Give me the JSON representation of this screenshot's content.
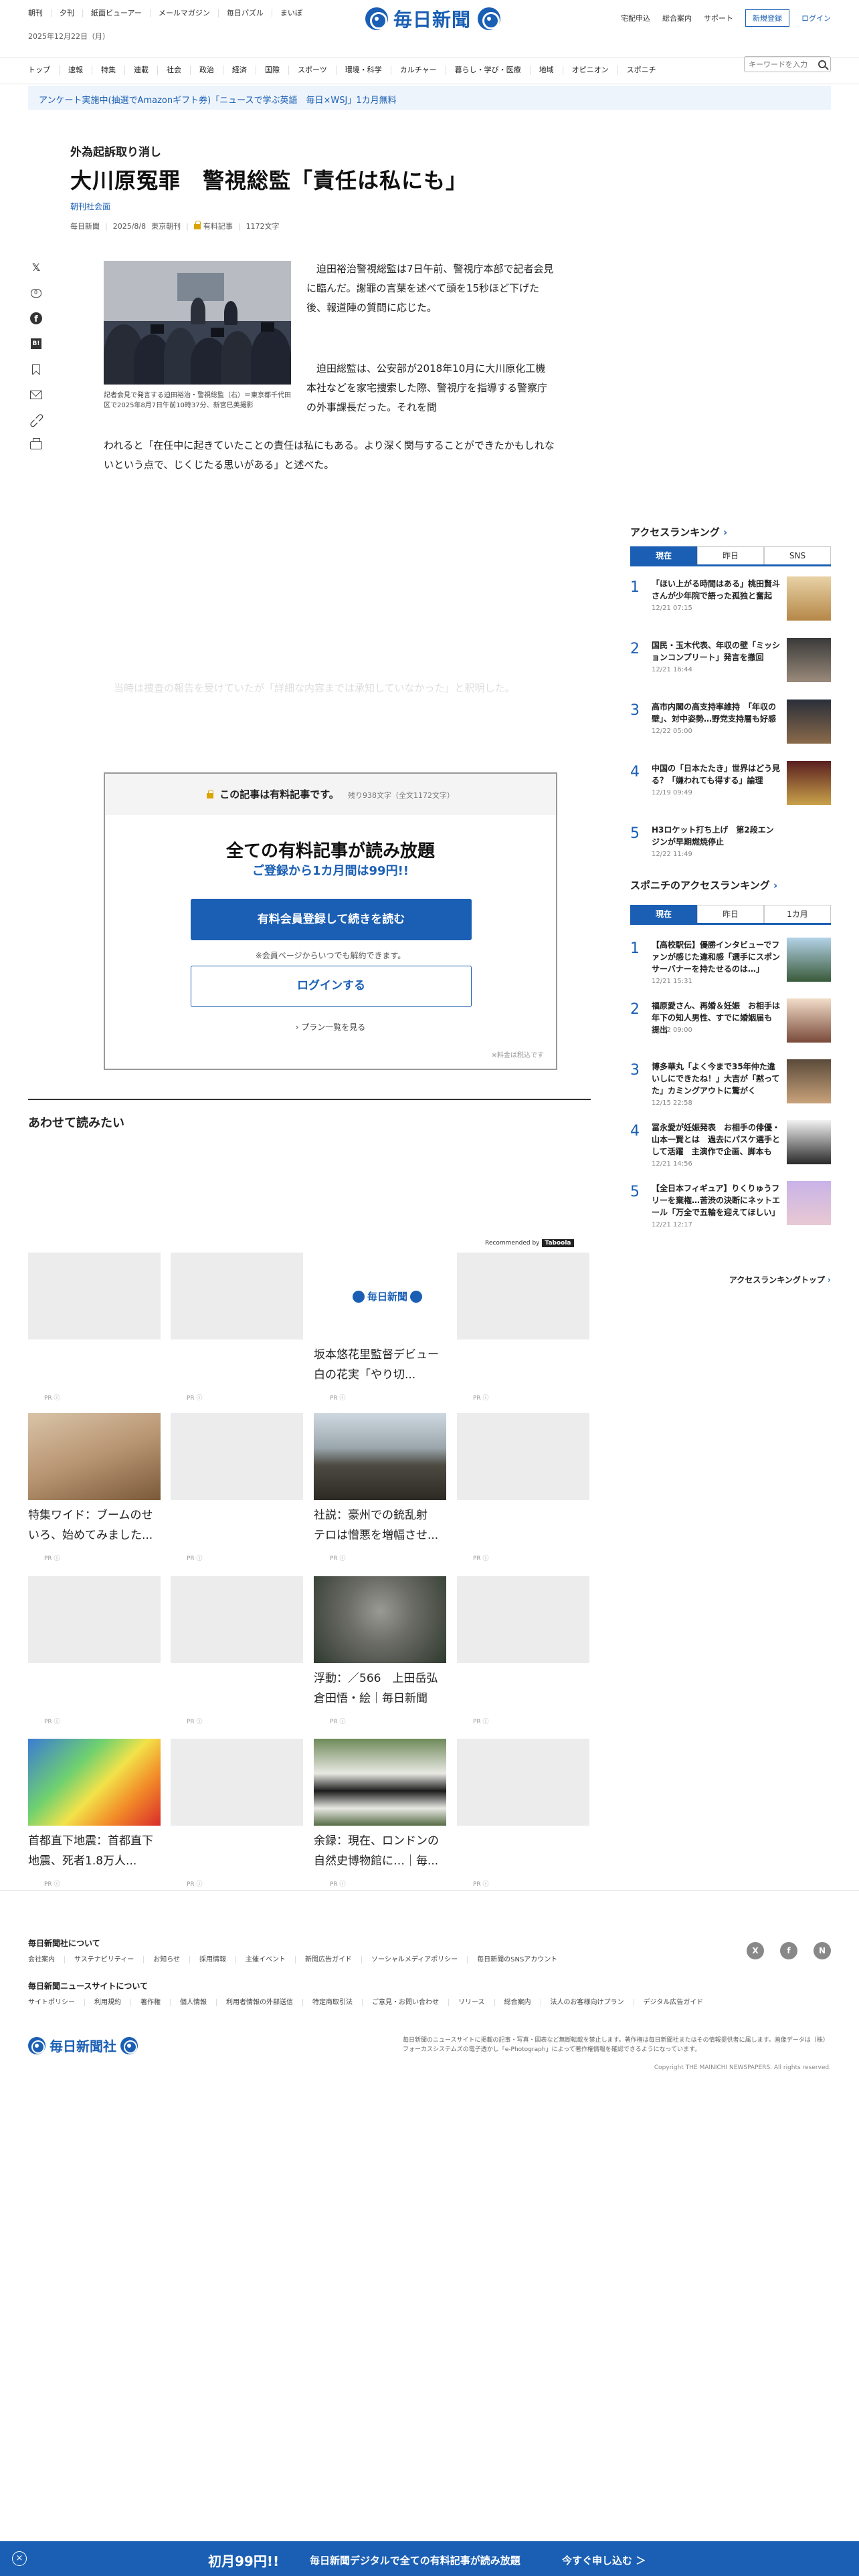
{
  "header": {
    "left_links": [
      "朝刊",
      "夕刊",
      "紙面ビューアー",
      "メールマガジン",
      "毎日パズル",
      "まいぽ"
    ],
    "date": "2025年12月22日（月）",
    "logo_text": "毎日新聞",
    "right_links": [
      "宅配申込",
      "総合案内",
      "サポート"
    ],
    "register_label": "新規登録",
    "login_label": "ログイン"
  },
  "nav": {
    "items": [
      "トップ",
      "速報",
      "特集",
      "連載",
      "社会",
      "政治",
      "経済",
      "国際",
      "スポーツ",
      "環境・科学",
      "カルチャー",
      "暮らし・学び・医療",
      "地域",
      "オピニオン",
      "スポニチ"
    ],
    "search_placeholder": "キーワードを入力"
  },
  "banner": {
    "text": "アンケート実施中(抽選でAmazonギフト券)「ニュースで学ぶ英語　毎日×WSJ」1カ月無料"
  },
  "article": {
    "kicker": "外為起訴取り消し",
    "headline": "大川原冤罪　警視総監「責任は私にも」",
    "section": "朝刊社会面",
    "source": "毎日新聞",
    "date": "2025/8/8",
    "edition": "東京朝刊",
    "paid_label": "有料記事",
    "char_count": "1172文字",
    "caption": "記者会見で発言する迫田裕治・警視総監（右）＝東京都千代田区で2025年8月7日午前10時37分、新宮巳美撮影",
    "para1": "迫田裕治警視総監は7日午前、警視庁本部で記者会見に臨んだ。謝罪の言葉を述べて頭を15秒ほど下げた後、報道陣の質問に応じた。",
    "para2_a": "迫田総監は、公安部が2018年10月に大川原化工機本社などを家宅捜索した際、警視庁を指導する警察庁の外事課長だった。それを問われると「在任中に起きていたことの責任は私にもある。より深く関与することができたかもしれないという点で、じくじたる思いがある」と述べた。",
    "faded": "当時は捜査の報告を受けていたが「詳細な内容までは承知していなかった」と釈明した。"
  },
  "paywall": {
    "head": "この記事は有料記事です。",
    "remaining": "残り938文字（全文1172文字）",
    "title": "全ての有料記事が読み放題",
    "subtitle": "ご登録から1カ月間は99円!!",
    "primary_button": "有料会員登録して続きを読む",
    "note": "※会員ページからいつでも解約できます。",
    "login_button": "ログインする",
    "plans_link": "プラン一覧を見る",
    "tax": "※料金は税込です"
  },
  "related": {
    "heading": "あわせて読みたい",
    "recommended_by": "Recommended by",
    "taboola": "Taboola",
    "pr": "PR",
    "cards": [
      {
        "title": ""
      },
      {
        "title": ""
      },
      {
        "title": "坂本悠花里監督デビュー　白の花実「やり切..."
      },
      {
        "title": ""
      },
      {
        "title": "特集ワイド：ブームのせいろ、始めてみました..."
      },
      {
        "title": ""
      },
      {
        "title": "社説：豪州での銃乱射　テロは憎悪を増幅させ..."
      },
      {
        "title": ""
      },
      {
        "title": ""
      },
      {
        "title": ""
      },
      {
        "title": "浮動：／566　上田岳弘　倉田悟・絵｜毎日新聞"
      },
      {
        "title": ""
      },
      {
        "title": "首都直下地震：首都直下地震、死者1.8万人..."
      },
      {
        "title": ""
      },
      {
        "title": "余録：現在、ロンドンの自然史博物館に…｜毎..."
      },
      {
        "title": ""
      }
    ]
  },
  "sidebar": {
    "ranking_title": "アクセスランキング",
    "ranking_tabs": [
      "現在",
      "昨日",
      "SNS"
    ],
    "ranking": [
      {
        "num": "1",
        "text": "「ほい上がる時間はある」桃田賢斗さんが少年院で語った孤独と奮起",
        "time": "12/21 07:15"
      },
      {
        "num": "2",
        "text": "国民・玉木代表、年収の壁「ミッションコンプリート」発言を撤回",
        "time": "12/21 16:44"
      },
      {
        "num": "3",
        "text": "高市内閣の高支持率維持　「年収の壁」、対中姿勢…野党支持層も好感",
        "time": "12/22 05:00"
      },
      {
        "num": "4",
        "text": "中国の「日本たたき」世界はどう見る？「嫌われても得する」論理",
        "time": "12/19 09:49"
      },
      {
        "num": "5",
        "text": "H3ロケット打ち上げ　第2段エンジンが早期燃焼停止",
        "time": "12/22 11:49"
      }
    ],
    "sponichi_title": "スポニチのアクセスランキング",
    "sponichi_tabs": [
      "現在",
      "昨日",
      "1カ月"
    ],
    "sponichi": [
      {
        "num": "1",
        "text": "【高校駅伝】優勝インタビューでファンが感じた違和感「選手にスポンサーバナーを持たせるのは…」",
        "time": "12/21 15:31"
      },
      {
        "num": "2",
        "text": "福原愛さん、再婚＆妊娠　お相手は年下の知人男性、すでに婚姻届も提出",
        "time": "12/22 09:00"
      },
      {
        "num": "3",
        "text": "博多華丸「よく今まで35年仲た違いしにできたね！」大吉が「黙ってた」カミングアウトに驚がく",
        "time": "12/15 22:58"
      },
      {
        "num": "4",
        "text": "冨永愛が妊娠発表　お相手の俳優・山本一賢とは　過去にパスケ選手として活躍　主演作で企画、脚本も",
        "time": "12/21 14:56"
      },
      {
        "num": "5",
        "text": "【全日本フィギュア】りくりゅうフリーを棄権…苦渋の決断にネットエール「万全で五輪を迎えてほしい」",
        "time": "12/21 12:17"
      }
    ],
    "ranking_more": "アクセスランキングトップ"
  },
  "footer": {
    "about_head": "毎日新聞社について",
    "about_links": [
      "会社案内",
      "サステナビリティー",
      "お知らせ",
      "採用情報",
      "主催イベント",
      "新聞広告ガイド",
      "ソーシャルメディアポリシー",
      "毎日新聞のSNSアカウント"
    ],
    "site_head": "毎日新聞ニュースサイトについて",
    "site_links": [
      "サイトポリシー",
      "利用規約",
      "著作権",
      "個人情報",
      "利用者情報の外部送信",
      "特定商取引法",
      "ご意見・お問い合わせ",
      "リリース",
      "総合案内",
      "法人のお客様向けプラン",
      "デジタル広告ガイド"
    ],
    "sns": [
      "X",
      "f",
      "N"
    ],
    "company": "毎日新聞社",
    "note": "毎日新聞のニュースサイトに掲載の記事・写真・図表など無断転載を禁止します。著作権は毎日新聞社またはその情報提供者に属します。画像データは（株）フォーカスシステムズの電子透かし「e-Photograph」によって著作権情報を確認できるようになっています。",
    "copyright": "Copyright THE MAINICHI NEWSPAPERS. All rights reserved."
  },
  "bottom_bar": {
    "price": "初月99円!!",
    "text": "毎日新聞デジタルで全ての有料記事が読み放題",
    "cta": "今すぐ申し込む ＞",
    "close": "×"
  }
}
